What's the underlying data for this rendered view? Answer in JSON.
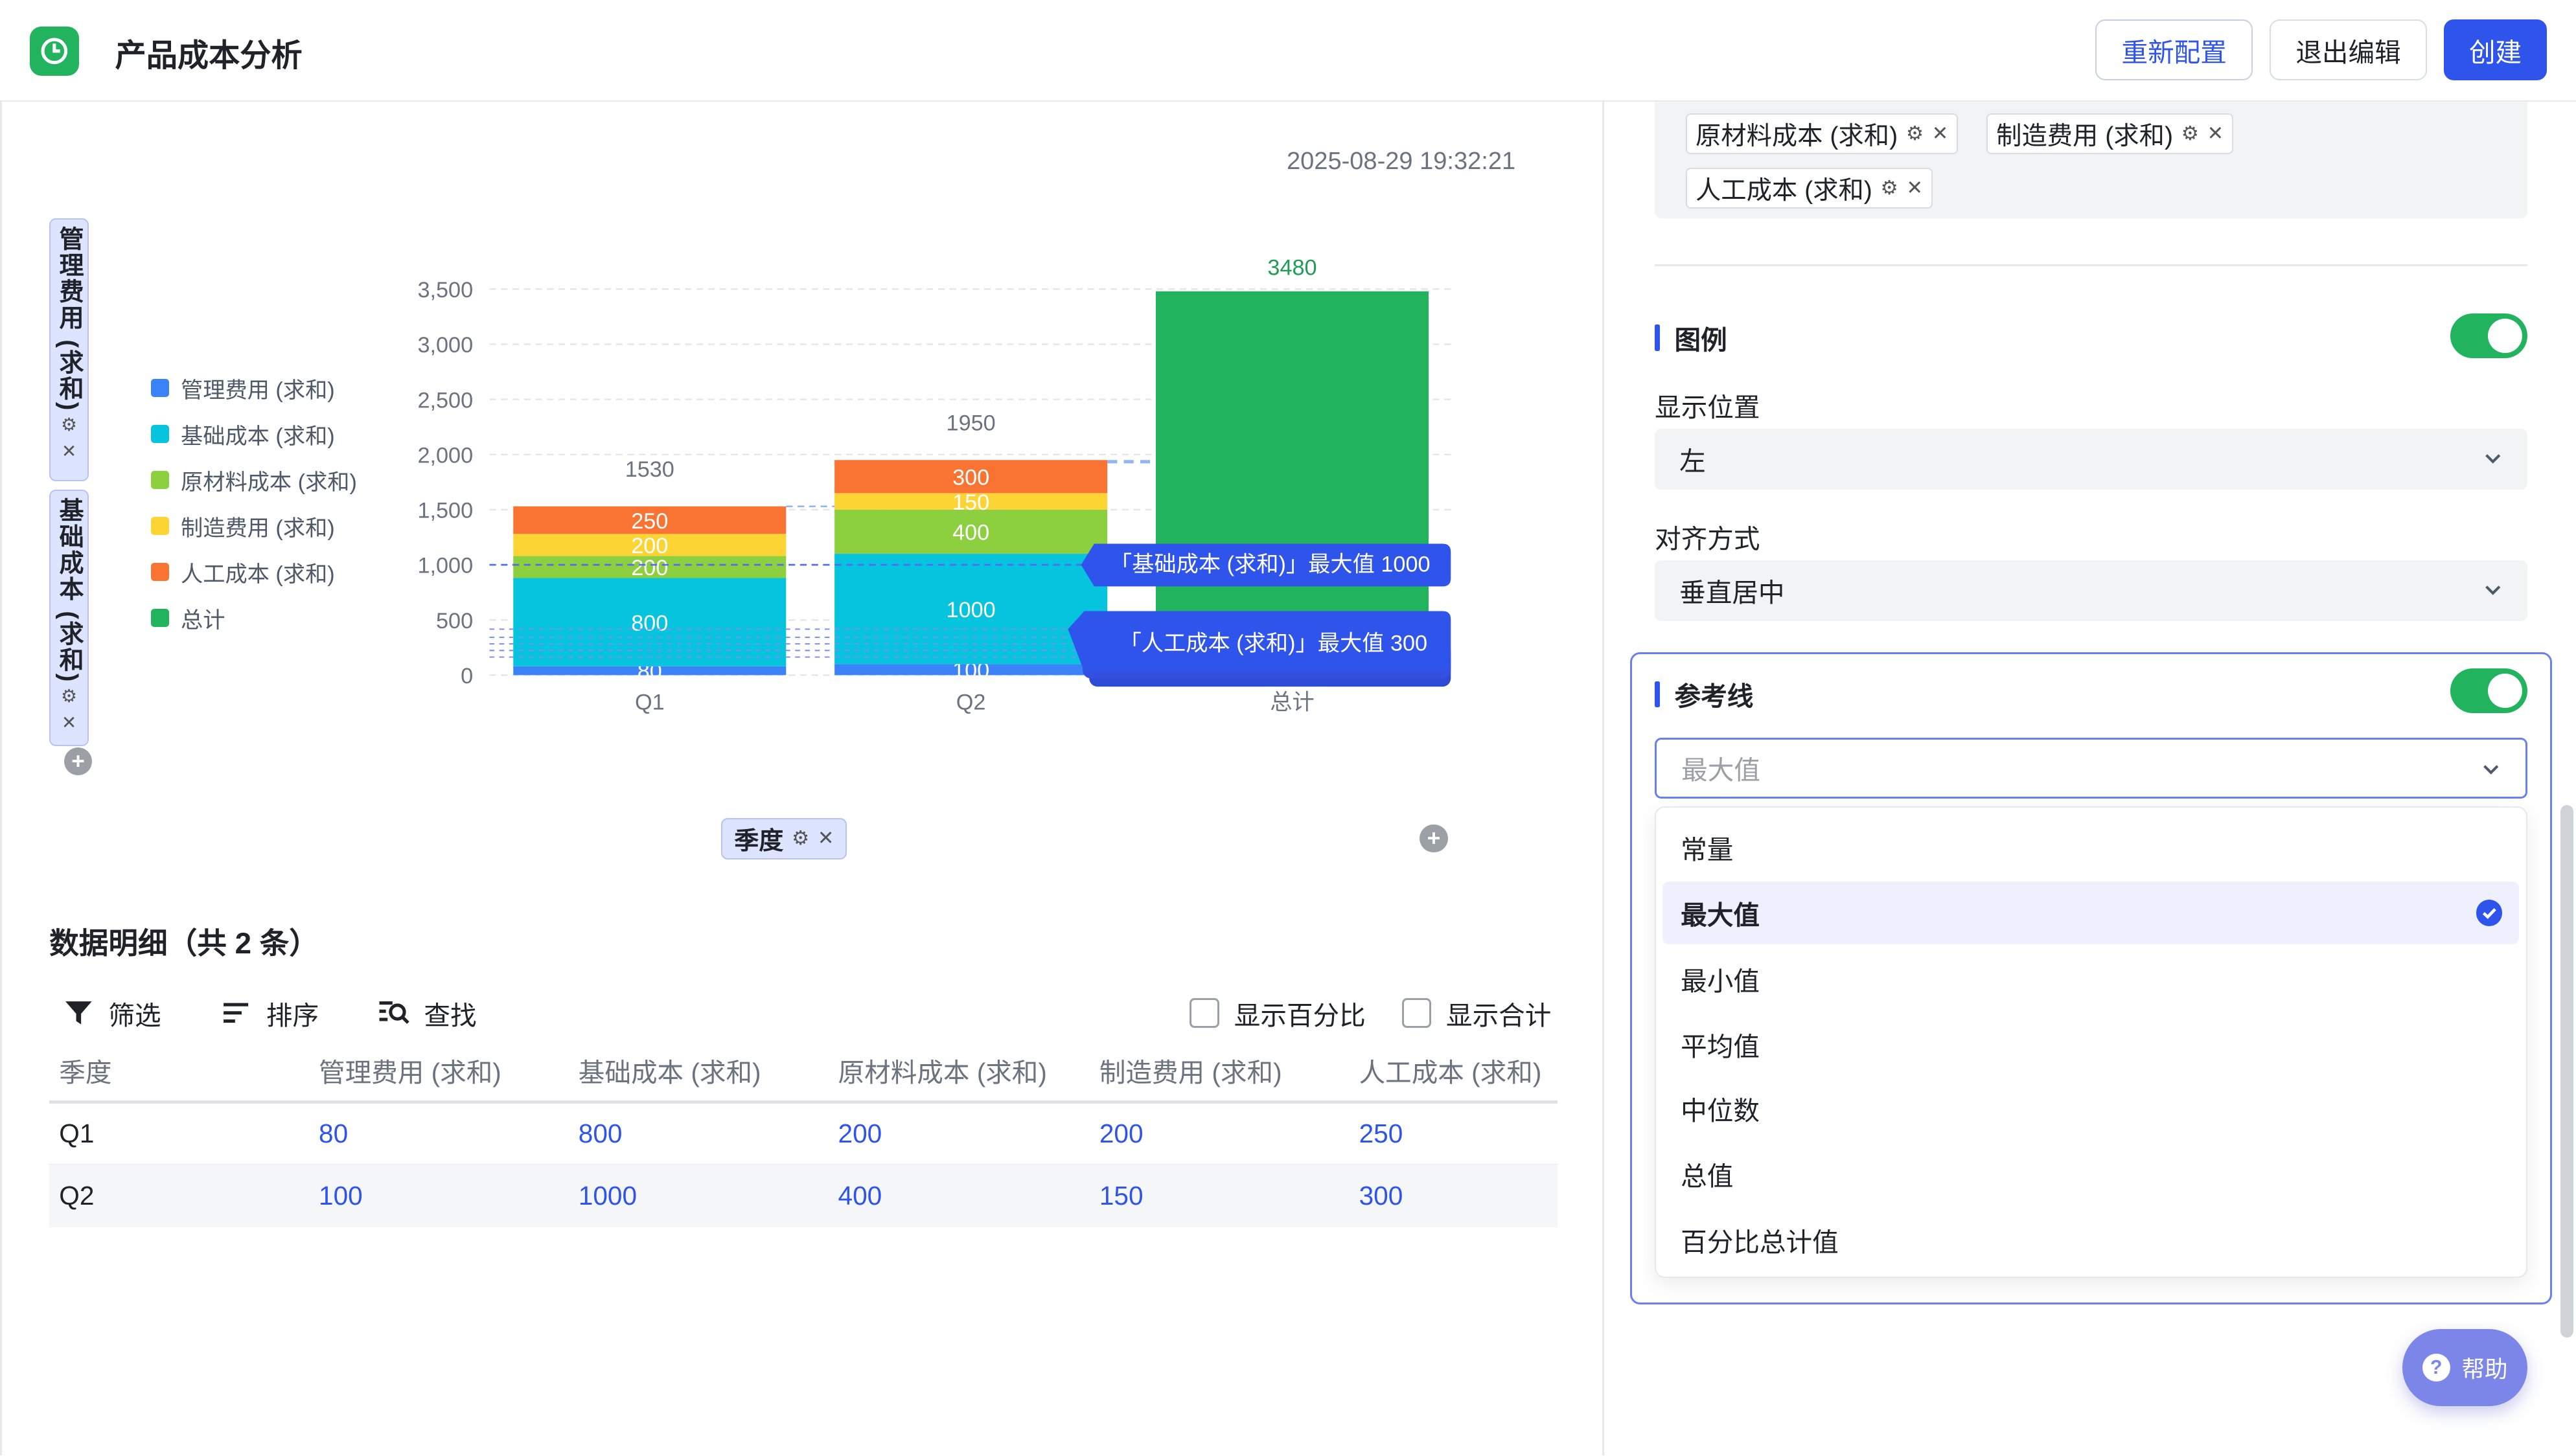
{
  "header": {
    "title": "产品成本分析",
    "reconfig": "重新配置",
    "exit": "退出编辑",
    "create": "创建"
  },
  "chart_area": {
    "timestamp": "2025-08-29 19:32:21",
    "y_fields": [
      "管理费用 (求和)",
      "基础成本 (求和)"
    ],
    "x_field": "季度"
  },
  "chart_data": {
    "type": "bar",
    "stacked": true,
    "categories": [
      "Q1",
      "Q2",
      "总计"
    ],
    "series": [
      {
        "name": "管理费用 (求和)",
        "color": "#3b82f6",
        "values": [
          80,
          100,
          null
        ]
      },
      {
        "name": "基础成本 (求和)",
        "color": "#06c4de",
        "values": [
          800,
          1000,
          null
        ]
      },
      {
        "name": "原材料成本 (求和)",
        "color": "#8ccf3f",
        "values": [
          200,
          400,
          null
        ]
      },
      {
        "name": "制造费用 (求和)",
        "color": "#fcd535",
        "values": [
          200,
          150,
          null
        ]
      },
      {
        "name": "人工成本 (求和)",
        "color": "#f97432",
        "values": [
          250,
          300,
          null
        ]
      },
      {
        "name": "总计",
        "color": "#22b35e",
        "values": [
          null,
          null,
          3480
        ]
      }
    ],
    "totals": [
      1530,
      1950,
      3480
    ],
    "yticks": [
      "0",
      "500",
      "1,000",
      "1,500",
      "2,000",
      "2,500",
      "3,000",
      "3,500"
    ],
    "ylim": [
      0,
      3500
    ],
    "legend_position": "left",
    "reference_labels": [
      {
        "text": "「基础成本 (求和)」最大值 1000",
        "value": 1000
      },
      {
        "text": "「人工成本 (求和)」最大值 300",
        "value": 300
      }
    ]
  },
  "table": {
    "title": "数据明细（共 2 条）",
    "tools": [
      "筛选",
      "排序",
      "查找"
    ],
    "show_percent": "显示百分比",
    "show_total": "显示合计",
    "columns": [
      "季度",
      "管理费用 (求和)",
      "基础成本 (求和)",
      "原材料成本 (求和)",
      "制造费用 (求和)",
      "人工成本 (求和)"
    ],
    "rows": [
      [
        "Q1",
        "80",
        "800",
        "200",
        "200",
        "250"
      ],
      [
        "Q2",
        "100",
        "1000",
        "400",
        "150",
        "300"
      ]
    ]
  },
  "panel": {
    "chips": [
      "原材料成本 (求和)",
      "制造费用 (求和)",
      "人工成本 (求和)"
    ],
    "legend_title": "图例",
    "position_label": "显示位置",
    "position_value": "左",
    "align_label": "对齐方式",
    "align_value": "垂直居中",
    "ref_title": "参考线",
    "ref_placeholder": "最大值",
    "options": [
      "常量",
      "最大值",
      "最小值",
      "平均值",
      "中位数",
      "总值",
      "百分比总计值"
    ],
    "selected_option": "最大值"
  },
  "help": "帮助"
}
